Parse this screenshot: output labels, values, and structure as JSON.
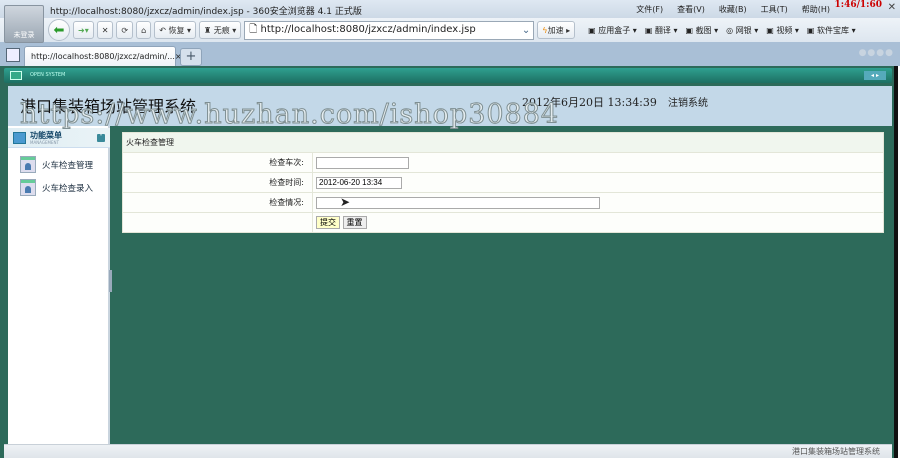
{
  "browser": {
    "avatar_label": "未登录",
    "title": "http://localhost:8080/jzxcz/admin/index.jsp - 360安全浏览器 4.1 正式版",
    "menu": [
      "文件(F)",
      "查看(V)",
      "收藏(B)",
      "工具(T)",
      "帮助(H)"
    ],
    "timer": "1:46/1:60",
    "restore_label": "恢复",
    "noprofile_label": "无痕",
    "url": "http://localhost:8080/jzxcz/admin/index.jsp",
    "accelerate_label": "加速",
    "tools": [
      "应用盒子",
      "翻译",
      "截图",
      "网银",
      "视频",
      "软件宝库"
    ],
    "tab_title": "http://localhost:8080/jzxcz/admin/..."
  },
  "app": {
    "system_bar": "OPEN SYSTEM",
    "system_name": "港口集装箱场站管理系统",
    "clock": "2012年6月20日  13:34:39",
    "logout": "注销系统",
    "watermark": "https://www.huzhan.com/ishop30884",
    "sidebar": {
      "title": "功能菜单",
      "subtitle": "MANAGEMENT",
      "items": [
        {
          "label": "火车检查管理"
        },
        {
          "label": "火车检查录入"
        }
      ]
    },
    "form": {
      "title": "火车检查管理",
      "fields": [
        {
          "label": "检查车次:",
          "value": ""
        },
        {
          "label": "检查时间:",
          "value": "2012-06-20 13:34"
        },
        {
          "label": "检查情况:",
          "value": ""
        }
      ],
      "submit": "提交",
      "reset": "重置"
    },
    "status": "港口集装箱场站管理系统"
  }
}
